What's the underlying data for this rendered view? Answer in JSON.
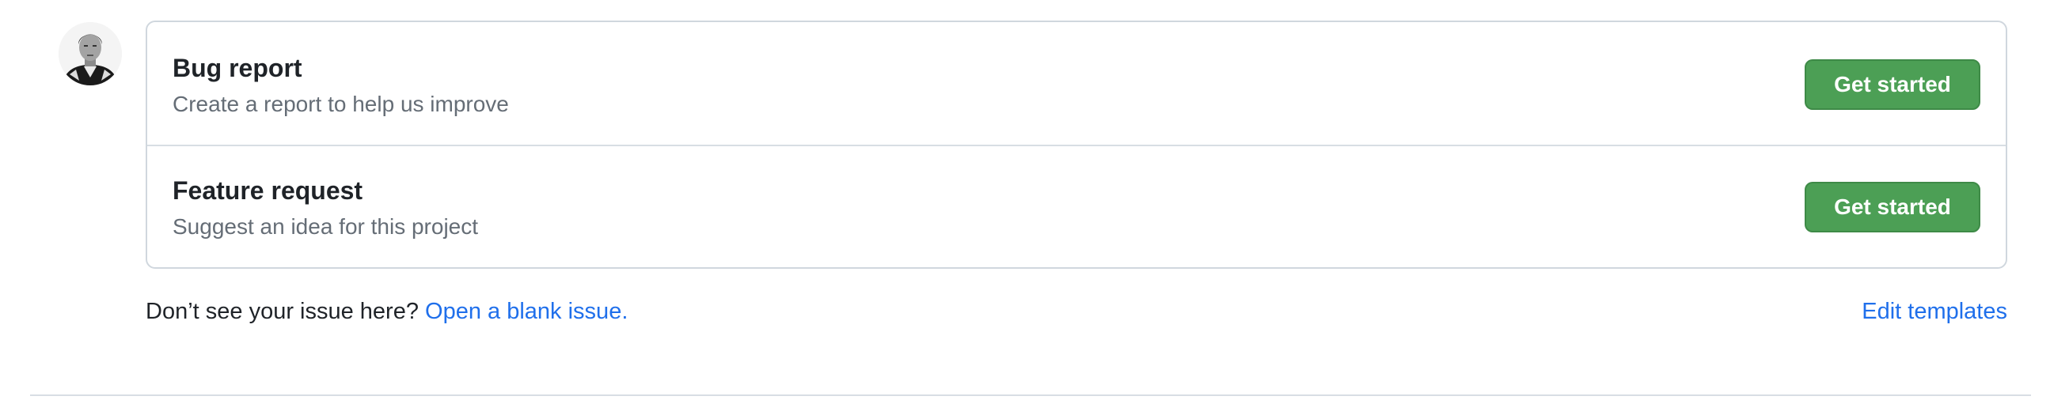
{
  "avatar": {
    "icon": "user-avatar-icon"
  },
  "templates": [
    {
      "title": "Bug report",
      "description": "Create a report to help us improve",
      "button_label": "Get started"
    },
    {
      "title": "Feature request",
      "description": "Suggest an idea for this project",
      "button_label": "Get started"
    }
  ],
  "footer": {
    "prompt": "Don’t see your issue here?",
    "blank_issue_link": "Open a blank issue.",
    "edit_templates_link": "Edit templates"
  },
  "colors": {
    "primary_button": "#4c9f55",
    "link": "#1f6feb",
    "border": "#d0d7de",
    "muted_text": "#656d76"
  }
}
